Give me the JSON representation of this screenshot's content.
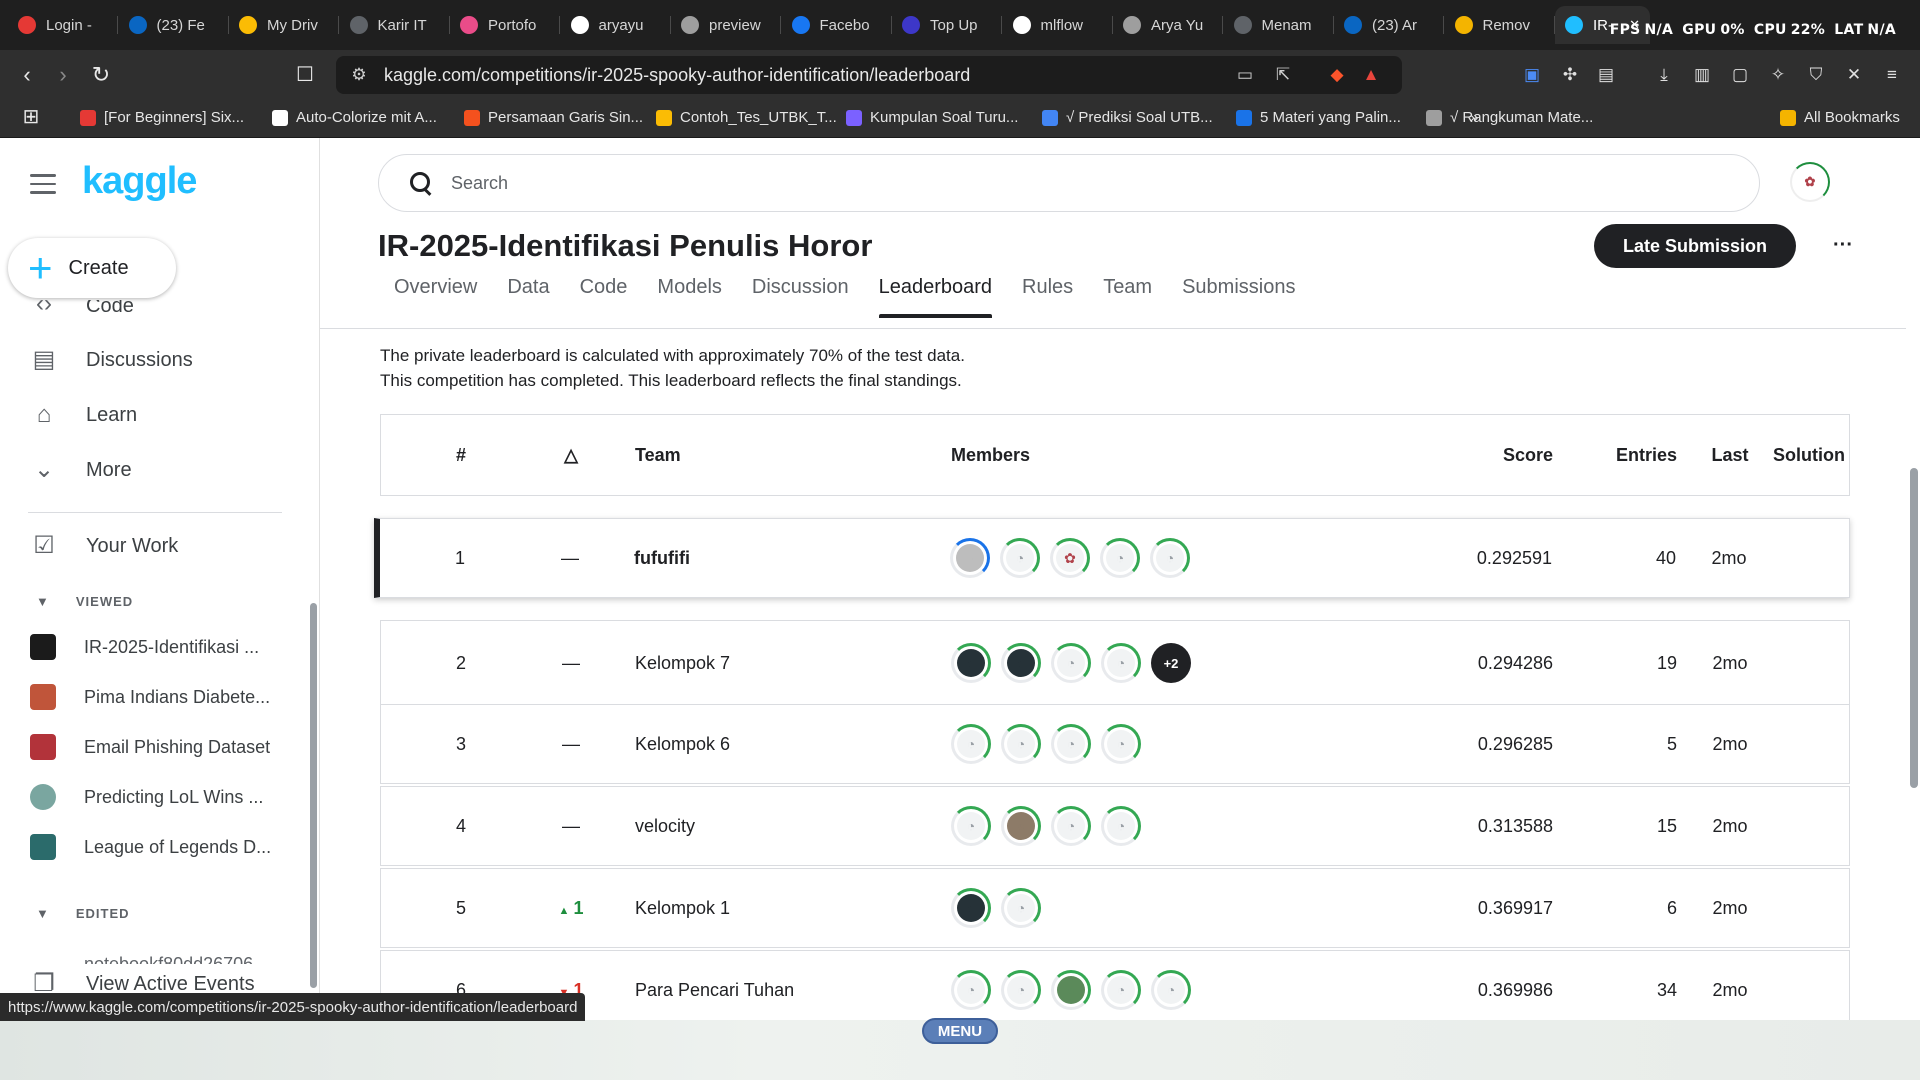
{
  "browser": {
    "tabs": [
      {
        "label": "Login -",
        "icon": "red-t-icon",
        "color": "#e53935"
      },
      {
        "label": "(23) Fe",
        "icon": "linkedin-icon",
        "color": "#0a66c2"
      },
      {
        "label": "My Driv",
        "icon": "drive-icon",
        "color": "#fbbc04"
      },
      {
        "label": "Karir IT",
        "icon": "chatgpt-icon",
        "color": "#5f6368"
      },
      {
        "label": "Portofo",
        "icon": "dribbble-icon",
        "color": "#ea4c89"
      },
      {
        "label": "aryayu",
        "icon": "github-icon",
        "color": "#ffffff"
      },
      {
        "label": "preview",
        "icon": "globe-icon",
        "color": "#9e9e9e"
      },
      {
        "label": "Facebo",
        "icon": "facebook-icon",
        "color": "#1877f2"
      },
      {
        "label": "Top Up",
        "icon": "topup-icon",
        "color": "#3d37c8"
      },
      {
        "label": "mlflow",
        "icon": "google-icon",
        "color": "#ffffff"
      },
      {
        "label": "Arya Yu",
        "icon": "globe-icon",
        "color": "#9e9e9e"
      },
      {
        "label": "Menam",
        "icon": "chatgpt-icon",
        "color": "#5f6368"
      },
      {
        "label": "(23) Ar",
        "icon": "linkedin-icon",
        "color": "#0a66c2"
      },
      {
        "label": "Remov",
        "icon": "remove-icon",
        "color": "#f4b400"
      },
      {
        "label": "IR-",
        "icon": "kaggle-icon",
        "color": "#20beff",
        "active": true
      }
    ],
    "perf": {
      "fps_label": "FPS",
      "fps": "N/A",
      "gpu_label": "GPU",
      "gpu": "0%",
      "cpu_label": "CPU",
      "cpu": "22%",
      "lat_label": "LAT",
      "lat": "N/A"
    },
    "url": "kaggle.com/competitions/ir-2025-spooky-author-identification/leaderboard",
    "bookmarks": [
      {
        "label": "[For Beginners] Six...",
        "color": "#e53935"
      },
      {
        "label": "Auto-Colorize mit A...",
        "color": "#ffffff"
      },
      {
        "label": "Persamaan Garis Sin...",
        "color": "#f4511e"
      },
      {
        "label": "Contoh_Tes_UTBK_T...",
        "color": "#fbbc04"
      },
      {
        "label": "Kumpulan Soal Turu...",
        "color": "#7b61ff"
      },
      {
        "label": "√ Prediksi Soal UTB...",
        "color": "#4285f4"
      },
      {
        "label": "5 Materi yang Palin...",
        "color": "#1a73e8"
      },
      {
        "label": "√ Rangkuman Mate...",
        "color": "#9e9e9e"
      }
    ],
    "bookmarks_overflow": "»",
    "all_bookmarks": "All Bookmarks",
    "status_url": "https://www.kaggle.com/competitions/ir-2025-spooky-author-identification/leaderboard"
  },
  "sidebar": {
    "logo": "kaggle",
    "create": "Create",
    "nav_partial": "Code",
    "nav": [
      {
        "label": "Discussions",
        "icon": "discussions-icon"
      },
      {
        "label": "Learn",
        "icon": "learn-icon"
      },
      {
        "label": "More",
        "icon": "chevron-down-icon"
      }
    ],
    "your_work": "Your Work",
    "viewed_header": "VIEWED",
    "viewed": [
      {
        "label": "IR-2025-Identifikasi ...",
        "color": "#1b1b1b"
      },
      {
        "label": "Pima Indians Diabete...",
        "color": "#c0553a"
      },
      {
        "label": "Email Phishing Dataset",
        "color": "#b2333a"
      },
      {
        "label": "Predicting LoL Wins ...",
        "color": "#7aa6a0"
      },
      {
        "label": "League of Legends D...",
        "color": "#2b6b6b"
      }
    ],
    "edited_header": "EDITED",
    "edited_partial": "notebookf80dd26706",
    "active_events": "View Active Events"
  },
  "main": {
    "search_placeholder": "Search",
    "profile_initials": "✿",
    "title": "IR-2025-Identifikasi Penulis Horor",
    "late_submission": "Late Submission",
    "more": "···",
    "tabs": [
      "Overview",
      "Data",
      "Code",
      "Models",
      "Discussion",
      "Leaderboard",
      "Rules",
      "Team",
      "Submissions"
    ],
    "active_tab": "Leaderboard",
    "note1": "The private leaderboard is calculated with approximately 70% of the test data.",
    "note2": "This competition has completed. This leaderboard reflects the final standings."
  },
  "leaderboard": {
    "headers": {
      "rank": "#",
      "delta": "△",
      "team": "Team",
      "members": "Members",
      "score": "Score",
      "entries": "Entries",
      "last": "Last",
      "solution": "Solution"
    },
    "rows": [
      {
        "rank": "1",
        "delta": "—",
        "delta_dir": "none",
        "team": "fufufifi",
        "members": 5,
        "more": "",
        "score": "0.292591",
        "entries": "40",
        "last": "2mo"
      },
      {
        "rank": "2",
        "delta": "—",
        "delta_dir": "none",
        "team": "Kelompok 7",
        "members": 4,
        "more": "+2",
        "score": "0.294286",
        "entries": "19",
        "last": "2mo"
      },
      {
        "rank": "3",
        "delta": "—",
        "delta_dir": "none",
        "team": "Kelompok 6",
        "members": 4,
        "more": "",
        "score": "0.296285",
        "entries": "5",
        "last": "2mo"
      },
      {
        "rank": "4",
        "delta": "—",
        "delta_dir": "none",
        "team": "velocity",
        "members": 4,
        "more": "",
        "score": "0.313588",
        "entries": "15",
        "last": "2mo"
      },
      {
        "rank": "5",
        "delta": "1",
        "delta_dir": "up",
        "team": "Kelompok 1",
        "members": 2,
        "more": "",
        "score": "0.369917",
        "entries": "6",
        "last": "2mo"
      },
      {
        "rank": "6",
        "delta": "1",
        "delta_dir": "down",
        "team": "Para Pencari Tuhan",
        "members": 5,
        "more": "",
        "score": "0.369986",
        "entries": "34",
        "last": "2mo"
      }
    ]
  },
  "taskbar": {
    "menu": "MENU"
  }
}
